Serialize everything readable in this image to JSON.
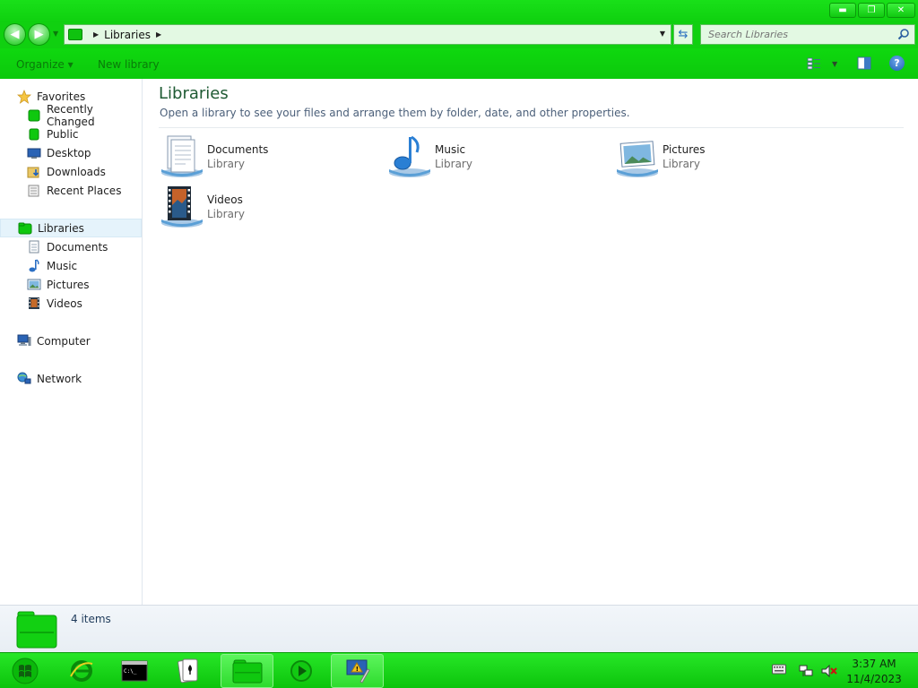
{
  "window": {
    "title_buttons": {
      "minimize": "▬",
      "maximize": "❐",
      "close": "✕"
    }
  },
  "address": {
    "path": [
      "Libraries"
    ],
    "search_placeholder": "Search Libraries"
  },
  "toolbar": {
    "organize": "Organize ▾",
    "new_library": "New library"
  },
  "navpane": {
    "favorites": {
      "label": "Favorites",
      "items": [
        "Recently Changed",
        "Public",
        "Desktop",
        "Downloads",
        "Recent Places"
      ]
    },
    "libraries": {
      "label": "Libraries",
      "items": [
        "Documents",
        "Music",
        "Pictures",
        "Videos"
      ]
    },
    "computer": "Computer",
    "network": "Network"
  },
  "content": {
    "title": "Libraries",
    "description": "Open a library to see your files and arrange them by folder, date, and other properties.",
    "tiles": [
      {
        "name": "Documents",
        "type": "Library",
        "icon": "documents-library-icon"
      },
      {
        "name": "Music",
        "type": "Library",
        "icon": "music-library-icon"
      },
      {
        "name": "Pictures",
        "type": "Library",
        "icon": "pictures-library-icon"
      },
      {
        "name": "Videos",
        "type": "Library",
        "icon": "videos-library-icon"
      }
    ]
  },
  "details": {
    "count": "4 items"
  },
  "taskbar": {
    "clock_time": "3:37 AM",
    "clock_date": "11/4/2023"
  },
  "colors": {
    "accent": "#10d010",
    "title_text": "#1e5a33"
  }
}
